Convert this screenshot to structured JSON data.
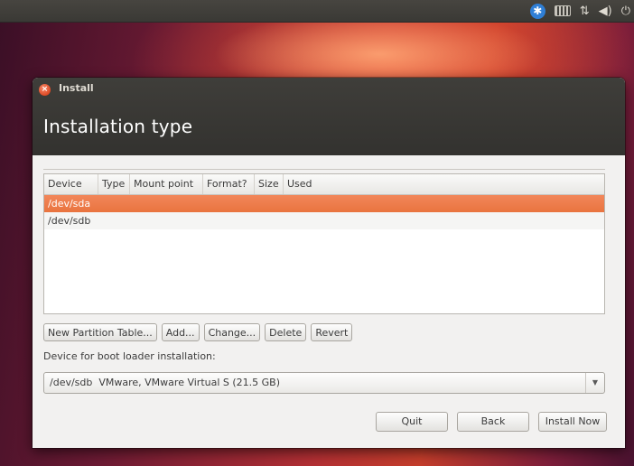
{
  "window": {
    "title": "Install",
    "heading": "Installation type"
  },
  "table": {
    "columns": [
      "Device",
      "Type",
      "Mount point",
      "Format?",
      "Size",
      "Used"
    ],
    "rows": [
      "/dev/sda",
      "/dev/sdb"
    ],
    "selected_row": 0
  },
  "buttons": {
    "new_partition_table": "New Partition Table...",
    "add": "Add...",
    "change": "Change...",
    "delete": "Delete",
    "revert": "Revert"
  },
  "bootloader": {
    "label": "Device for boot loader installation:",
    "selected": "/dev/sdb  VMware, VMware Virtual S (21.5 GB)"
  },
  "footer": {
    "quit": "Quit",
    "back": "Back",
    "install_now": "Install Now"
  },
  "tray": {
    "icons": [
      "accessibility-icon",
      "keyboard-icon",
      "network-icon",
      "volume-icon",
      "power-icon"
    ]
  },
  "colors": {
    "selection": "#e9743f",
    "titlebar": "#3c3b37"
  }
}
